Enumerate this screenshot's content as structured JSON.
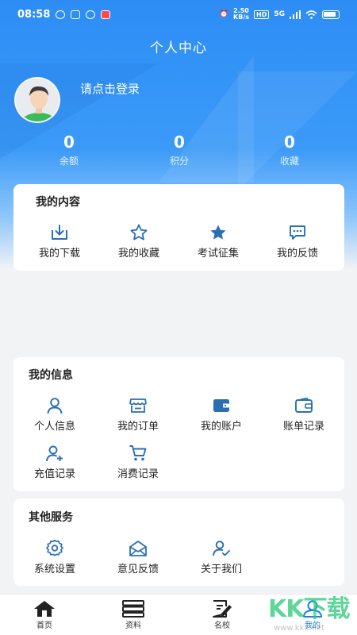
{
  "status_bar": {
    "time": "08:58",
    "speed_value": "2.50",
    "speed_unit": "KB/s",
    "hd": "HD",
    "net": "5G"
  },
  "header": {
    "title": "个人中心",
    "login_prompt": "请点击登录"
  },
  "stats": [
    {
      "value": "0",
      "label": "余额"
    },
    {
      "value": "0",
      "label": "积分"
    },
    {
      "value": "0",
      "label": "收藏"
    }
  ],
  "my_content": {
    "title": "我的内容",
    "items": [
      {
        "label": "我的下载",
        "icon": "download-icon"
      },
      {
        "label": "我的收藏",
        "icon": "star-outline-icon"
      },
      {
        "label": "考试征集",
        "icon": "star-filled-icon"
      },
      {
        "label": "我的反馈",
        "icon": "chat-icon"
      }
    ]
  },
  "my_info": {
    "title": "我的信息",
    "items": [
      {
        "label": "个人信息",
        "icon": "person-icon"
      },
      {
        "label": "我的订单",
        "icon": "store-icon"
      },
      {
        "label": "我的账户",
        "icon": "wallet-filled-icon"
      },
      {
        "label": "账单记录",
        "icon": "wallet-icon"
      },
      {
        "label": "充值记录",
        "icon": "person-add-icon"
      },
      {
        "label": "消费记录",
        "icon": "cart-icon"
      }
    ]
  },
  "other_services": {
    "title": "其他服务",
    "items": [
      {
        "label": "系统设置",
        "icon": "gear-icon"
      },
      {
        "label": "意见反馈",
        "icon": "mail-icon"
      },
      {
        "label": "关于我们",
        "icon": "person-check-icon"
      }
    ]
  },
  "tabbar": {
    "items": [
      {
        "label": "首页",
        "icon": "home-icon"
      },
      {
        "label": "资料",
        "icon": "database-icon"
      },
      {
        "label": "名校",
        "icon": "edit-doc-icon"
      },
      {
        "label": "我的",
        "icon": "user-icon"
      }
    ],
    "active": "我的"
  },
  "watermark": {
    "text": "KK下载",
    "sub": "www.kkx.net"
  },
  "colors": {
    "accent": "#1f7fe8",
    "header": "#2d8df5",
    "icon": "#2a6fb5"
  }
}
